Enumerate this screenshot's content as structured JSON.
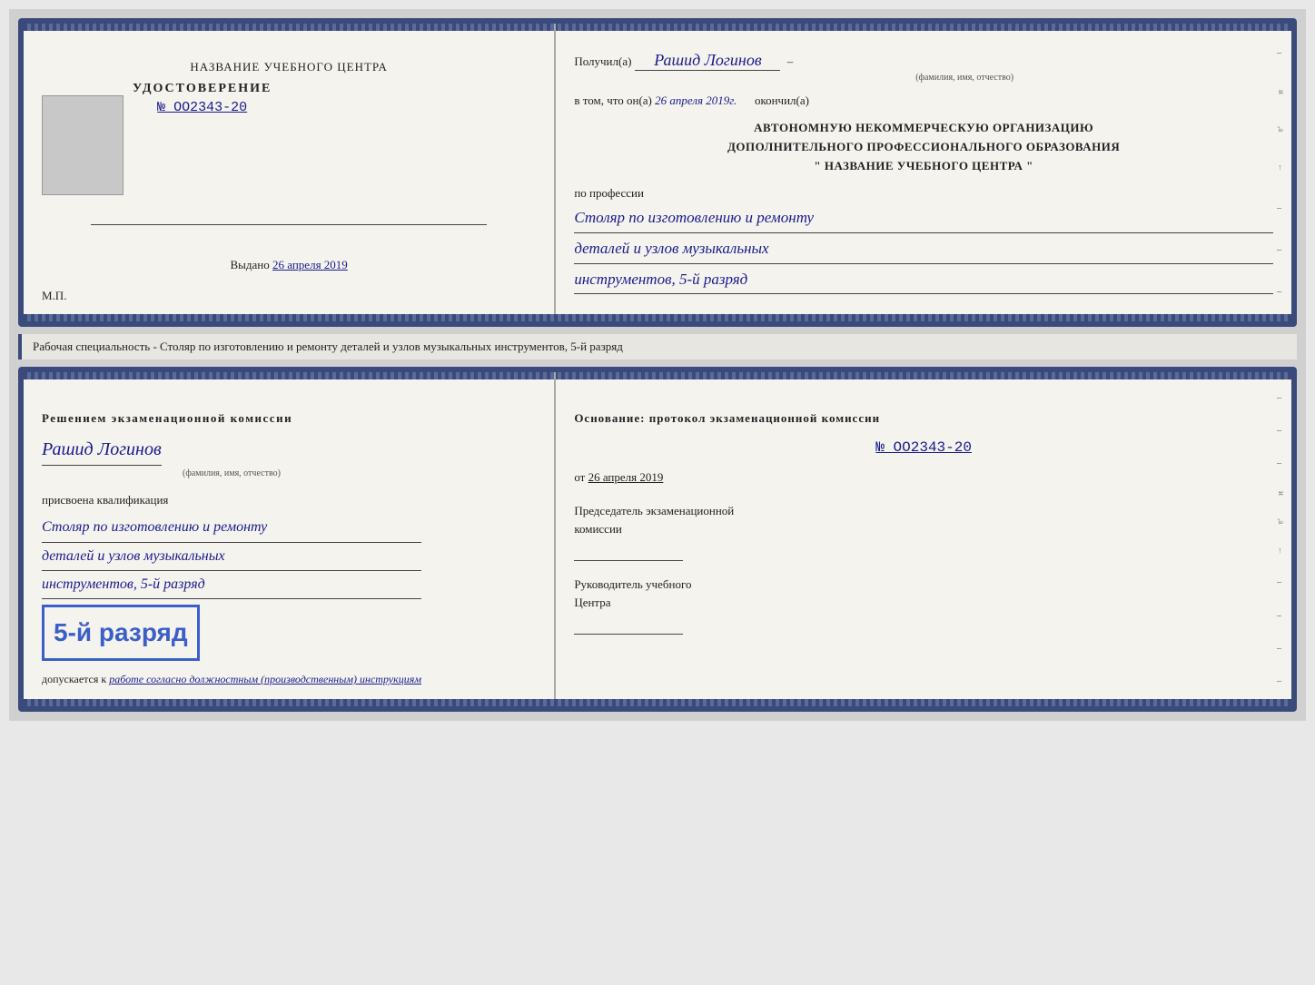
{
  "top_doc": {
    "left": {
      "title": "НАЗВАНИЕ УЧЕБНОГО ЦЕНТРА",
      "udostoverenie": "УДОСТОВЕРЕНИЕ",
      "number": "№ OO2343-20",
      "vydano_label": "Выдано",
      "vydano_date": "26 апреля 2019",
      "mp": "М.П."
    },
    "right": {
      "poluchil_label": "Получил(а)",
      "poluchil_name": "Рашид Логинов",
      "fio_caption": "(фамилия, имя, отчество)",
      "vtom_label": "в том, что он(а)",
      "vtom_date": "26 апреля 2019г.",
      "okonchil_label": "окончил(а)",
      "org_line1": "АВТОНОМНУЮ НЕКОММЕРЧЕСКУЮ ОРГАНИЗАЦИЮ",
      "org_line2": "ДОПОЛНИТЕЛЬНОГО ПРОФЕССИОНАЛЬНОГО ОБРАЗОВАНИЯ",
      "org_line3": "\"  НАЗВАНИЕ УЧЕБНОГО ЦЕНТРА  \"",
      "po_professii": "по профессии",
      "profession_line1": "Столяр по изготовлению и ремонту",
      "profession_line2": "деталей и узлов музыкальных",
      "profession_line3": "инструментов, 5-й разряд"
    }
  },
  "middle_label": "Рабочая специальность - Столяр по изготовлению и ремонту деталей и узлов музыкальных инструментов, 5-й разряд",
  "bottom_doc": {
    "left": {
      "resheniem": "Решением экзаменационной комиссии",
      "person_name": "Рашид Логинов",
      "fio_caption": "(фамилия, имя, отчество)",
      "prisvoena": "присвоена квалификация",
      "kvali_line1": "Столяр по изготовлению и ремонту",
      "kvali_line2": "деталей и узлов музыкальных",
      "kvali_line3": "инструментов, 5-й разряд",
      "razryad_big": "5-й разряд",
      "dopuskaetsya_prefix": "допускается к",
      "dopuskaetsya_italic": "работе согласно должностным (производственным) инструкциям"
    },
    "right": {
      "osnovanie": "Основание: протокол экзаменационной комиссии",
      "protocol_number": "№  OO2343-20",
      "ot_label": "от",
      "ot_date": "26 апреля 2019",
      "predsedatel_line1": "Председатель экзаменационной",
      "predsedatel_line2": "комиссии",
      "rukovoditel_line1": "Руководитель учебного",
      "rukovoditel_line2": "Центра"
    }
  }
}
